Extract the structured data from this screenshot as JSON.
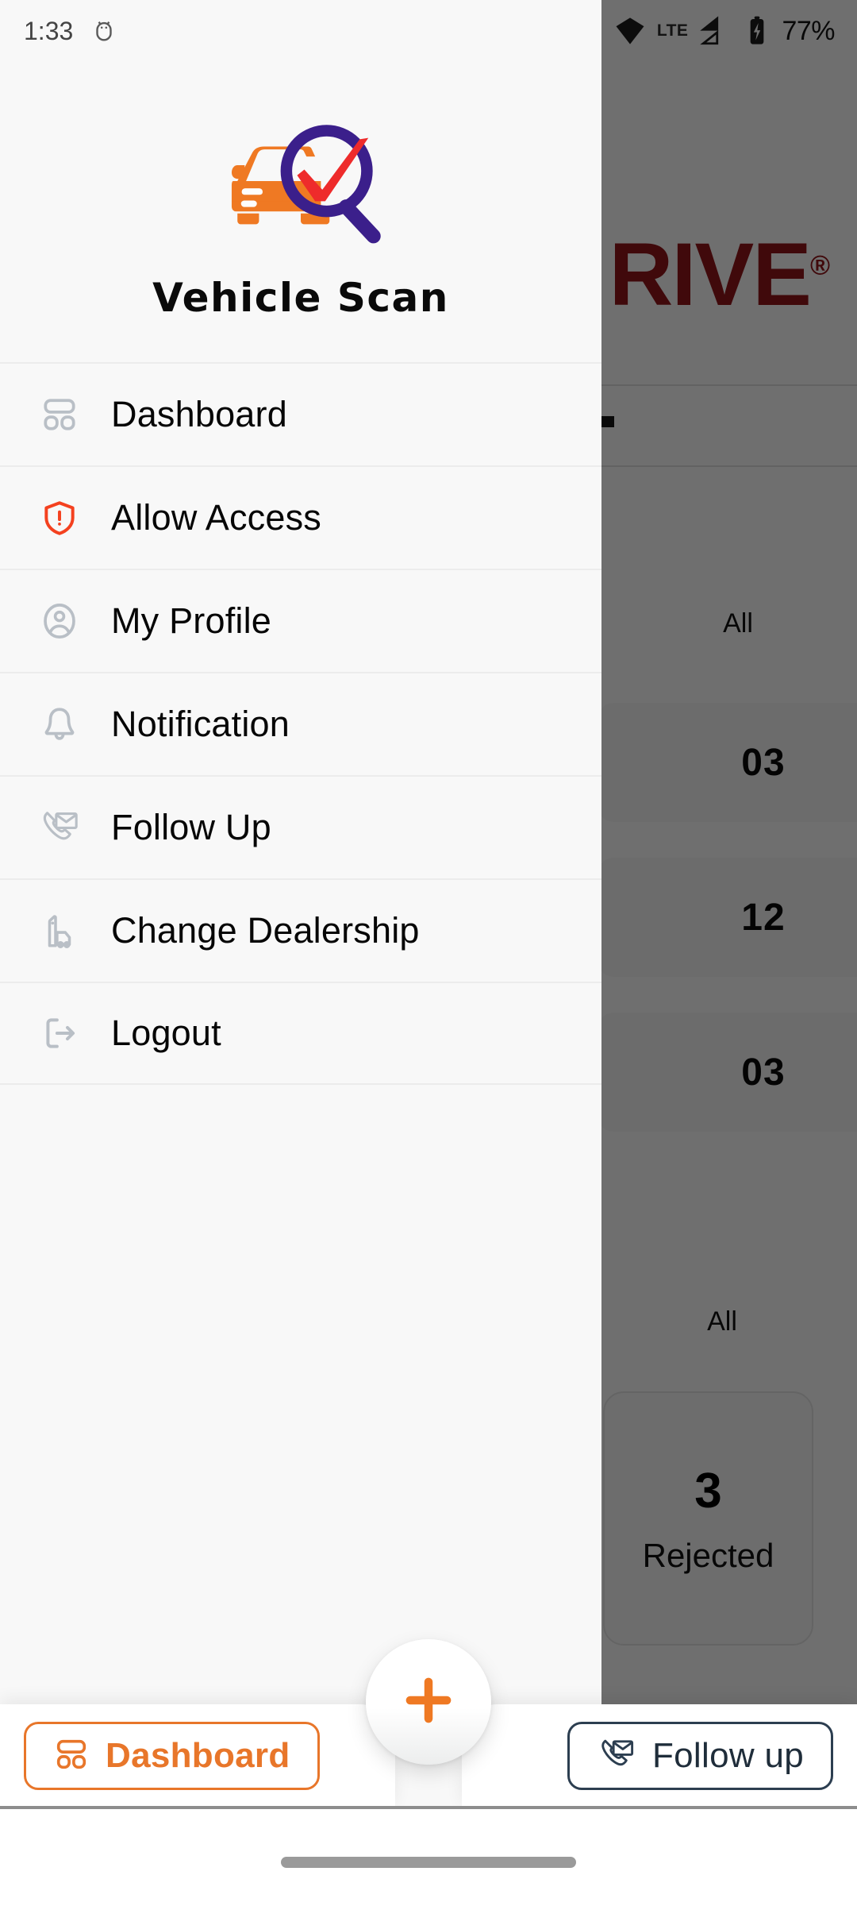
{
  "status_bar": {
    "time": "1:33",
    "left_icon": "android-robot-icon",
    "battery_percent": "77%",
    "network_label": "LTE",
    "icons": [
      "wifi-calling-icon",
      "wifi-icon",
      "signal-bars-icon",
      "battery-charging-icon"
    ]
  },
  "drawer": {
    "logo_icon": "vehicle-scan-logo",
    "app_title": "Vehicle Scan",
    "items": [
      {
        "label": "Dashboard",
        "icon": "dashboard-grid-icon"
      },
      {
        "label": "Allow Access",
        "icon": "shield-alert-icon"
      },
      {
        "label": "My Profile",
        "icon": "user-circle-icon"
      },
      {
        "label": "Notification",
        "icon": "bell-icon"
      },
      {
        "label": "Follow Up",
        "icon": "phone-envelope-icon"
      },
      {
        "label": "Change Dealership",
        "icon": "dealership-building-icon"
      },
      {
        "label": "Logout",
        "icon": "logout-arrow-icon"
      }
    ]
  },
  "bottom_bar": {
    "dashboard_label": "Dashboard",
    "dashboard_icon": "dashboard-grid-icon",
    "followup_label": "Follow up",
    "followup_icon": "phone-envelope-icon",
    "fab_icon": "plus-icon"
  },
  "background": {
    "brand_text": "RIVE",
    "brand_mark": "®",
    "filter_label_top": "All",
    "filter_label_bottom": "All",
    "stat_values": [
      "03",
      "12",
      "03"
    ],
    "rejected_count": "3",
    "rejected_label": "Rejected"
  },
  "colors": {
    "accent_orange": "#e8762a",
    "logo_purple": "#3b1f8b",
    "logo_red": "#ee2b2b",
    "brand_red": "#8e1519",
    "followup_navy": "#2c3e50",
    "alert_red": "#f4411f",
    "icon_gray": "#b9bfc6",
    "drawer_bg": "#f8f8f8"
  }
}
